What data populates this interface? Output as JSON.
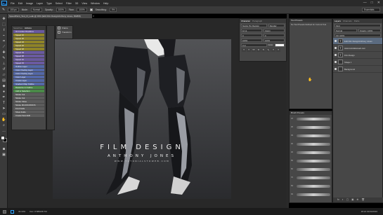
{
  "app": {
    "logo": "Ps"
  },
  "menu": [
    "File",
    "Edit",
    "Image",
    "Layer",
    "Type",
    "Select",
    "Filter",
    "3D",
    "View",
    "Window",
    "Help"
  ],
  "window_controls": [
    "—",
    "□",
    "✕"
  ],
  "options": {
    "size_value": "100 px",
    "mode_label": "Mode:",
    "mode_value": "Normal",
    "opacity_label": "Opacity:",
    "opacity_value": "100%",
    "flow_label": "Flow:",
    "flow_value": "100%",
    "smoothing_label": "Smoothing:",
    "smoothing_value": "0%",
    "workspace": "Essentials"
  },
  "document": {
    "tab_title": "SpeedPaint_Test_Fl_Leak @ 33% (Edit Film Design/Anthony Jones, RGB/8)",
    "zoom": "33.33%",
    "doc_size": "Doc: 8.58M/48.7M"
  },
  "canvas": {
    "title": "FILM DESIGN",
    "subtitle": "ANTHONY JONES",
    "url": "WWW.TUTORIALSTOWEB.COM"
  },
  "actions_panel": {
    "tabs": [
      "Swatches",
      "Actions"
    ],
    "items": [
      {
        "label": "On Invoke Checkbox",
        "color": "#6a5aa0"
      },
      {
        "label": "Speed 16",
        "color": "#8f8428"
      },
      {
        "label": "Speed 20",
        "color": "#8f8428"
      },
      {
        "label": "Speed 24",
        "color": "#8f8428"
      },
      {
        "label": "Speed 22",
        "color": "#8f8428"
      },
      {
        "label": "Speed 18",
        "color": "#8f8428"
      },
      {
        "label": "Speed 04",
        "color": "#6a5aa0"
      },
      {
        "label": "Speed 08",
        "color": "#6a5aa0"
      },
      {
        "label": "Speed 10",
        "color": "#6a5aa0"
      },
      {
        "label": "Speed 15",
        "color": "#6a5aa0"
      },
      {
        "label": "Outline Layer",
        "color": "#5468a8"
      },
      {
        "label": "Color Overlay Layer",
        "color": "#5468a8"
      },
      {
        "label": "Color Overlay Layer",
        "color": "#5468a8"
      },
      {
        "label": "Color Layer",
        "color": "#5468a8"
      },
      {
        "label": "Create Layer",
        "color": "#5468a8"
      },
      {
        "label": "Gradient Map Outline",
        "color": "#5468a8"
      },
      {
        "label": "Rasterize in Outline",
        "color": "#4a8a48"
      },
      {
        "label": "Add to Selection",
        "color": "#4a8a48"
      },
      {
        "label": "Stroke Cut",
        "color": "#5c5c5c"
      },
      {
        "label": "Stroke Cut",
        "color": "#5c5c5c"
      },
      {
        "label": "Stroke Close",
        "color": "#5c5c5c"
      },
      {
        "label": "Stroke 3D-DOC/DOCS",
        "color": "#5c5c5c"
      },
      {
        "label": "Find Folds",
        "color": "#5c5c5c"
      },
      {
        "label": "Show Folds",
        "color": "#5c5c5c"
      },
      {
        "label": "Create Face Edit",
        "color": "#5c5c5c"
      }
    ]
  },
  "props_panel": {
    "rows": [
      "Frame",
      "Transform"
    ]
  },
  "character_panel": {
    "tabs": [
      "Character",
      "Paragraph"
    ],
    "font": "Nunito Pro Regular",
    "style": "Regular",
    "size": "12 pt",
    "leading": "(Auto)",
    "tracking": "0",
    "scale_v": "100%",
    "scale_h": "100%",
    "baseline": "0 pt",
    "color_label": "Color:",
    "typestyles": [
      "T",
      "T",
      "TT",
      "Tr",
      "T¹",
      "T₁",
      "T",
      "T"
    ]
  },
  "tool_presets": {
    "title": "Tool Presets",
    "note": "No Tool Presets Defined for Current Tool"
  },
  "brush_panel": {
    "tabs": [
      "Brush Presets"
    ],
    "numbers": [
      "24",
      "36",
      "39",
      "40",
      "46",
      "56",
      "60",
      "70",
      "84",
      "93"
    ]
  },
  "layers_panel": {
    "tabs": [
      "Layers",
      "Channels",
      "Paths"
    ],
    "kind_label": "Kind",
    "blend": "Normal",
    "opacity": "Opacity: 100%",
    "fill": "Fill: 100%",
    "layers": [
      {
        "name": "Edit Film Design/Anthony Jones",
        "thumb": "T",
        "selected": true
      },
      {
        "name": "www.tutorialstoweb.com",
        "thumb": "T",
        "selected": false
      },
      {
        "name": "Film Design",
        "thumb": "T",
        "selected": false
      },
      {
        "name": "Shape 1",
        "thumb": "",
        "selected": false
      },
      {
        "name": "Background",
        "thumb": "",
        "selected": false
      }
    ],
    "footer_icons": [
      "fx",
      "◐",
      "▢",
      "▣",
      "⊕",
      "🗑"
    ]
  },
  "status": {
    "time": "18:24",
    "date": "01/04/2016"
  }
}
